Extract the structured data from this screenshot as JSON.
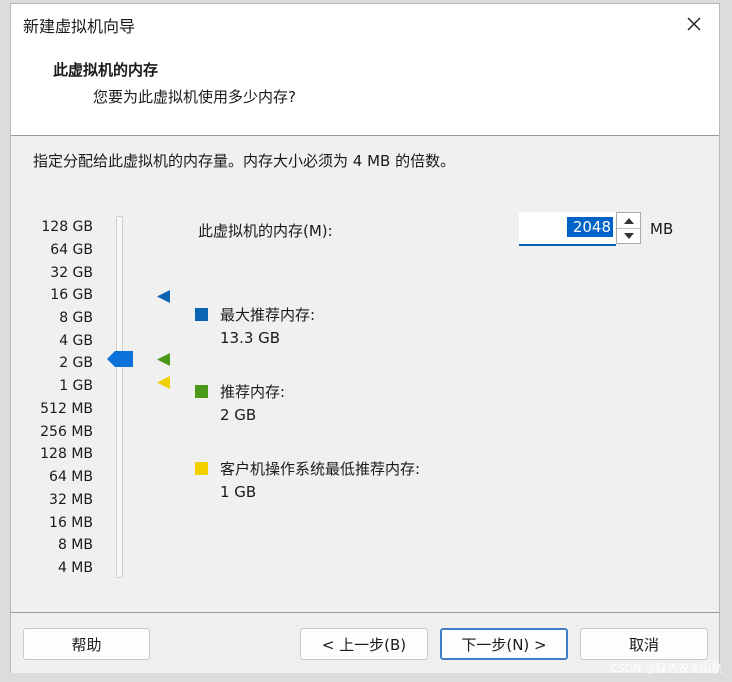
{
  "window": {
    "title": "新建虚拟机向导"
  },
  "header": {
    "title": "此虚拟机的内存",
    "subtitle": "您要为此虚拟机使用多少内存?"
  },
  "instruction": "指定分配给此虚拟机的内存量。内存大小必须为 4 MB 的倍数。",
  "scale": {
    "labels": [
      "128 GB",
      "64 GB",
      "32 GB",
      "16 GB",
      "8 GB",
      "4 GB",
      "2 GB",
      "1 GB",
      "512 MB",
      "256 MB",
      "128 MB",
      "64 MB",
      "32 MB",
      "16 MB",
      "8 MB",
      "4 MB"
    ],
    "current_label": "2 GB"
  },
  "memory": {
    "label": "此虚拟机的内存(M):",
    "value": "2048",
    "unit": "MB"
  },
  "legend": {
    "max": {
      "title": "最大推荐内存:",
      "value": "13.3 GB",
      "color": "#0a64b4",
      "position_label": "16 GB"
    },
    "recommended": {
      "title": "推荐内存:",
      "value": "2 GB",
      "color": "#4a9a18",
      "position_label": "2 GB"
    },
    "minimum": {
      "title": "客户机操作系统最低推荐内存:",
      "value": "1 GB",
      "color": "#f2d000",
      "position_label": "1 GB"
    }
  },
  "buttons": {
    "help": "帮助",
    "back": "< 上一步(B)",
    "next": "下一步(N) >",
    "cancel": "取消"
  },
  "watermark": "CSDN @绿色农夫山泉",
  "icons": {
    "close": "close-icon",
    "spin_up": "spin-up-icon",
    "spin_down": "spin-down-icon",
    "thumb": "slider-thumb-icon"
  }
}
